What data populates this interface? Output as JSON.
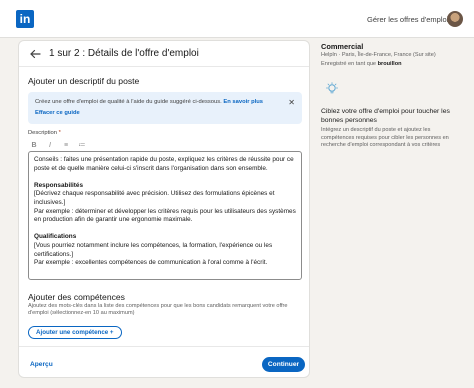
{
  "nav": {
    "logo_text": "in",
    "manage_link": "Gérer les offres d'emploi"
  },
  "card": {
    "title": "1 sur 2 : Détails de l'offre d'emploi",
    "section_title": "Ajouter un descriptif du poste",
    "info": {
      "text": "Créez une offre d'emploi de qualité à l'aide du guide suggéré ci-dessous.",
      "link": "En savoir plus",
      "clear_link": "Effacer ce guide",
      "close": "✕"
    },
    "description_label": "Description",
    "required_mark": "*",
    "toolbar": [
      "B",
      "I",
      "≡",
      "≔"
    ],
    "editor": {
      "intro": "Conseils : faites une présentation rapide du poste, expliquez les critères de réussite pour ce poste et de quelle manière celui-ci s'inscrit dans l'organisation dans son ensemble.",
      "resp_heading": "Responsabilités",
      "resp_line": "[Décrivez chaque responsabilité avec précision. Utilisez des formulations épicènes et inclusives.]",
      "resp_example": "Par exemple : déterminer et développer les critères requis pour les utilisateurs des systèmes en production afin de garantir une ergonomie maximale.",
      "qual_heading": "Qualifications",
      "qual_line": "[Vous pourriez notamment inclure les compétences, la formation, l'expérience ou les certifications.]",
      "qual_example": "Par exemple : excellentes compétences de communication à l'oral comme à l'écrit."
    },
    "skills_title": "Ajouter des compétences",
    "skills_sub": "Ajoutez des mots-clés dans la liste des compétences pour que les bons candidats remarquent votre offre d'emploi (sélectionnez-en 10 au maximum)",
    "add_skill_button": "Ajouter une compétence  +",
    "preview_link": "Aperçu",
    "continue_button": "Continuer"
  },
  "side": {
    "job_title": "Commercial",
    "meta": "Helpln  ·  Paris, Île-de-France, France (Sur site)",
    "saved_prefix": "Enregistré en tant que ",
    "saved_state": "brouillon",
    "tip_title": "Ciblez votre offre d'emploi pour toucher les bonnes personnes",
    "tip_text": "Intégrez un descriptif du poste et ajoutez les compétences requises pour cibler les personnes en recherche d'emploi correspondant à vos critères"
  },
  "colors": {
    "brand": "#0a66c2",
    "info_bg": "#e8f1fb",
    "page_bg": "#f4f2ee"
  },
  "icons": {
    "back": "arrow-left-icon",
    "close": "close-icon",
    "tip": "lightbulb-icon"
  }
}
